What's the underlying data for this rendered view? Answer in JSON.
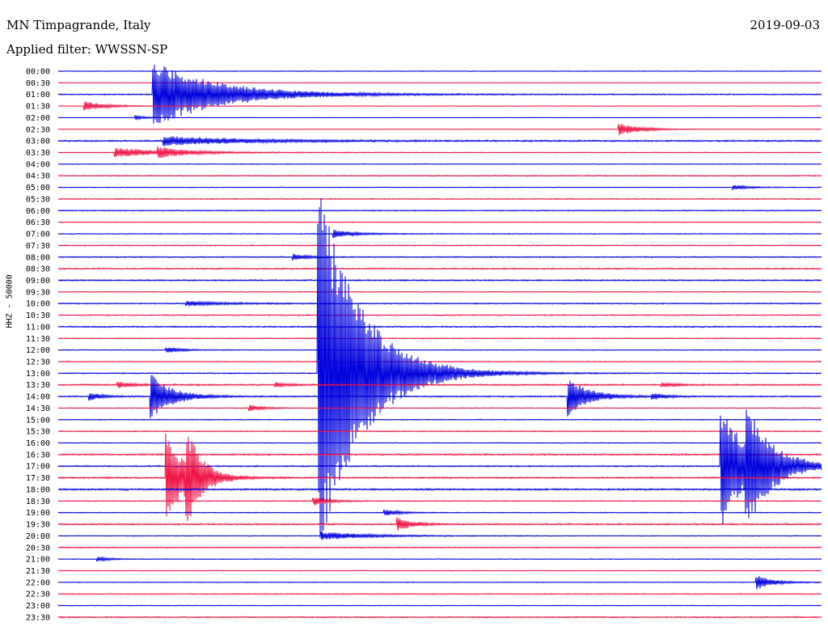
{
  "header": {
    "station": "MN Timpagrande, Italy",
    "filter": "Applied filter: WWSSN-SP",
    "date": "2019-09-03"
  },
  "chart_data": {
    "type": "line",
    "ylabel": "HHZ - 50000",
    "row_labels": [
      "00:00",
      "00:30",
      "01:00",
      "01:30",
      "02:00",
      "02:30",
      "03:00",
      "03:30",
      "04:00",
      "04:30",
      "05:00",
      "05:30",
      "06:00",
      "06:30",
      "07:00",
      "07:30",
      "08:00",
      "08:30",
      "09:00",
      "09:30",
      "10:00",
      "10:30",
      "11:00",
      "11:30",
      "12:00",
      "12:30",
      "13:00",
      "13:30",
      "14:00",
      "14:30",
      "15:00",
      "15:30",
      "16:00",
      "16:30",
      "17:00",
      "17:30",
      "18:00",
      "18:30",
      "19:00",
      "19:30",
      "20:00",
      "20:30",
      "21:00",
      "21:30",
      "22:00",
      "22:30",
      "23:00",
      "23:30"
    ],
    "series_colors": [
      "#0000dd",
      "#ee1144"
    ],
    "time_axis_minutes": [
      0,
      30
    ],
    "noise_level": [
      0.5,
      0.3,
      0.8,
      0.3,
      0.3,
      0.3,
      1.0,
      0.6,
      0.5,
      0.7,
      0.5,
      0.7,
      0.7,
      0.5,
      0.6,
      0.7,
      0.8,
      0.9,
      0.9,
      0.5,
      0.8,
      0.7,
      0.9,
      0.6,
      0.5,
      0.6,
      0.7,
      1.0,
      0.9,
      0.5,
      0.6,
      0.7,
      0.5,
      1.0,
      0.9,
      1.0,
      1.2,
      0.6,
      0.6,
      1.0,
      0.5,
      0.8,
      0.5,
      0.5,
      0.5,
      0.6,
      0.5,
      0.8
    ],
    "events": [
      {
        "row": 2,
        "minute": 3.7,
        "amplitude": 42,
        "decay": 2.5
      },
      {
        "row": 3,
        "minute": 1.0,
        "amplitude": 6,
        "decay": 0.8
      },
      {
        "row": 4,
        "minute": 3.0,
        "amplitude": 3,
        "decay": 0.4
      },
      {
        "row": 5,
        "minute": 22.0,
        "amplitude": 8,
        "decay": 0.8
      },
      {
        "row": 6,
        "minute": 4.1,
        "amplitude": 6,
        "decay": 3.0
      },
      {
        "row": 7,
        "minute": 2.2,
        "amplitude": 6,
        "decay": 1.8
      },
      {
        "row": 7,
        "minute": 3.9,
        "amplitude": 5,
        "decay": 1.0
      },
      {
        "row": 10,
        "minute": 26.5,
        "amplitude": 3,
        "decay": 0.6
      },
      {
        "row": 14,
        "minute": 10.8,
        "amplitude": 5,
        "decay": 0.8
      },
      {
        "row": 16,
        "minute": 9.2,
        "amplitude": 4,
        "decay": 0.6
      },
      {
        "row": 20,
        "minute": 5.0,
        "amplitude": 3,
        "decay": 1.5
      },
      {
        "row": 24,
        "minute": 4.2,
        "amplitude": 4,
        "decay": 0.6
      },
      {
        "row": 26,
        "minute": 10.2,
        "amplitude": 240,
        "decay": 1.6
      },
      {
        "row": 27,
        "minute": 2.3,
        "amplitude": 4,
        "decay": 0.6
      },
      {
        "row": 27,
        "minute": 8.5,
        "amplitude": 3,
        "decay": 0.5
      },
      {
        "row": 27,
        "minute": 23.7,
        "amplitude": 3,
        "decay": 0.5
      },
      {
        "row": 28,
        "minute": 1.2,
        "amplitude": 5,
        "decay": 0.5
      },
      {
        "row": 28,
        "minute": 3.6,
        "amplitude": 30,
        "decay": 0.8
      },
      {
        "row": 28,
        "minute": 20.0,
        "amplitude": 25,
        "decay": 0.8
      },
      {
        "row": 28,
        "minute": 23.3,
        "amplitude": 4,
        "decay": 0.5
      },
      {
        "row": 29,
        "minute": 7.5,
        "amplitude": 4,
        "decay": 0.5
      },
      {
        "row": 35,
        "minute": 4.2,
        "amplitude": 60,
        "decay": 0.8
      },
      {
        "row": 35,
        "minute": 5.0,
        "amplitude": 52,
        "decay": 0.5
      },
      {
        "row": 34,
        "minute": 26.0,
        "amplitude": 80,
        "decay": 1.0
      },
      {
        "row": 34,
        "minute": 27.0,
        "amplitude": 55,
        "decay": 1.0
      },
      {
        "row": 37,
        "minute": 10.0,
        "amplitude": 6,
        "decay": 0.6
      },
      {
        "row": 38,
        "minute": 12.8,
        "amplitude": 4,
        "decay": 0.6
      },
      {
        "row": 39,
        "minute": 13.3,
        "amplitude": 8,
        "decay": 0.6
      },
      {
        "row": 40,
        "minute": 10.3,
        "amplitude": 5,
        "decay": 1.8
      },
      {
        "row": 42,
        "minute": 1.5,
        "amplitude": 3,
        "decay": 0.5
      },
      {
        "row": 44,
        "minute": 27.4,
        "amplitude": 10,
        "decay": 0.6
      }
    ]
  }
}
